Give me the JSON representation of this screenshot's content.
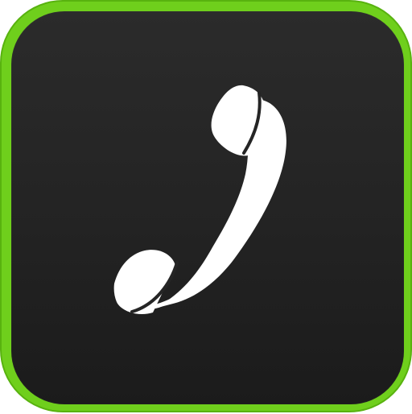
{
  "app": {
    "icon": "phone-handset-icon",
    "colors": {
      "border": "#6fcf1c",
      "background": "#252525",
      "glyph": "#ffffff"
    }
  }
}
